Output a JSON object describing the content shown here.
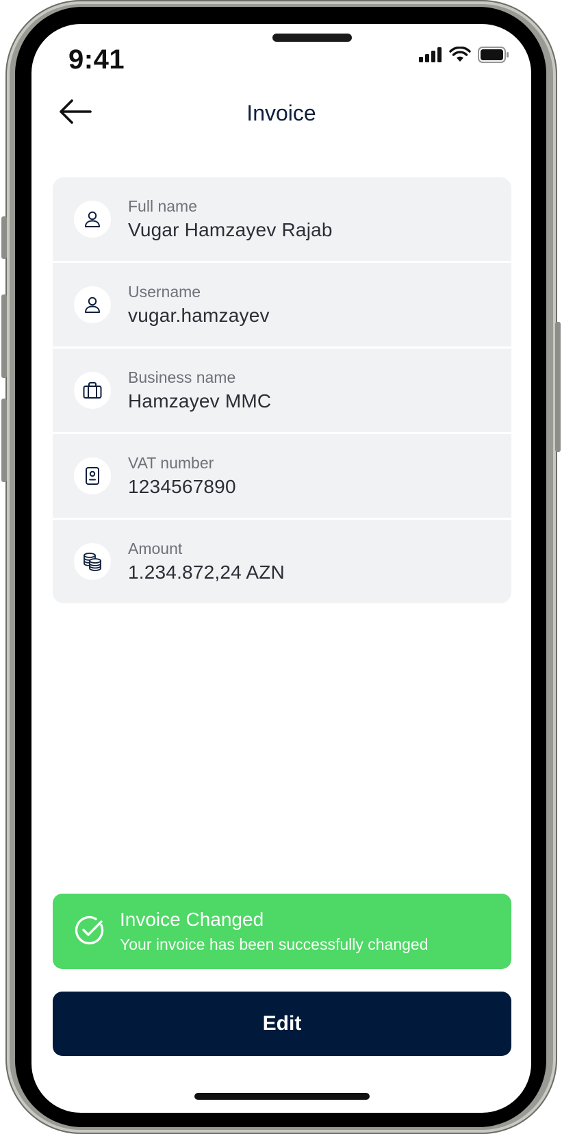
{
  "status_bar": {
    "time": "9:41",
    "icons": [
      "cellular-signal-icon",
      "wifi-icon",
      "battery-icon"
    ]
  },
  "header": {
    "title": "Invoice",
    "back_icon": "arrow-left-icon"
  },
  "details": [
    {
      "label": "Full name",
      "value": "Vugar Hamzayev Rajab",
      "icon": "user-icon"
    },
    {
      "label": "Username",
      "value": "vugar.hamzayev",
      "icon": "user-icon"
    },
    {
      "label": "Business name",
      "value": "Hamzayev MMC",
      "icon": "briefcase-icon"
    },
    {
      "label": "VAT number",
      "value": "1234567890",
      "icon": "id-badge-icon"
    },
    {
      "label": "Amount",
      "value": "1.234.872,24 AZN",
      "icon": "coins-icon"
    }
  ],
  "toast": {
    "title": "Invoice Changed",
    "message": "Your invoice has been successfully changed",
    "icon": "check-circle-icon"
  },
  "actions": {
    "edit_label": "Edit"
  },
  "colors": {
    "navy": "#011a3c",
    "success": "#4ed866",
    "row_bg": "#f1f2f4"
  }
}
